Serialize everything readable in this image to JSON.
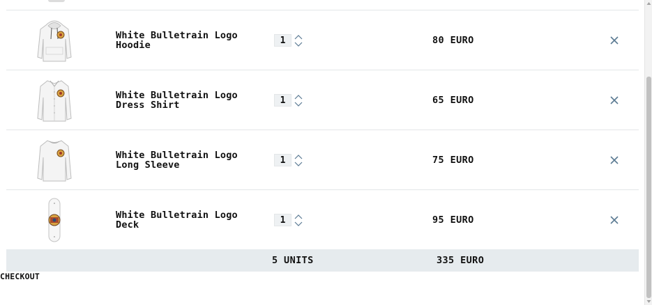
{
  "cart": {
    "items": [
      {
        "name": "White Bulletrain Logo Hoodie",
        "image": "hoodie-image",
        "quantity": "1",
        "price": "80 EURO"
      },
      {
        "name": "White Bulletrain Logo Dress Shirt",
        "image": "dress-shirt-image",
        "quantity": "1",
        "price": "65 EURO"
      },
      {
        "name": "White Bulletrain Logo Long Sleeve",
        "image": "long-sleeve-image",
        "quantity": "1",
        "price": "75 EURO"
      },
      {
        "name": "White Bulletrain Logo Deck",
        "image": "skate-deck-image",
        "quantity": "1",
        "price": "95 EURO"
      }
    ],
    "totals": {
      "units": "5 UNITS",
      "price": "335 EURO"
    },
    "checkout_label": "CHECKOUT"
  },
  "colors": {
    "totals_bg": "#e6ebee",
    "qty_bg": "#eef1f3",
    "remove_icon": "#5b7a93",
    "divider": "#e3e6e8"
  }
}
